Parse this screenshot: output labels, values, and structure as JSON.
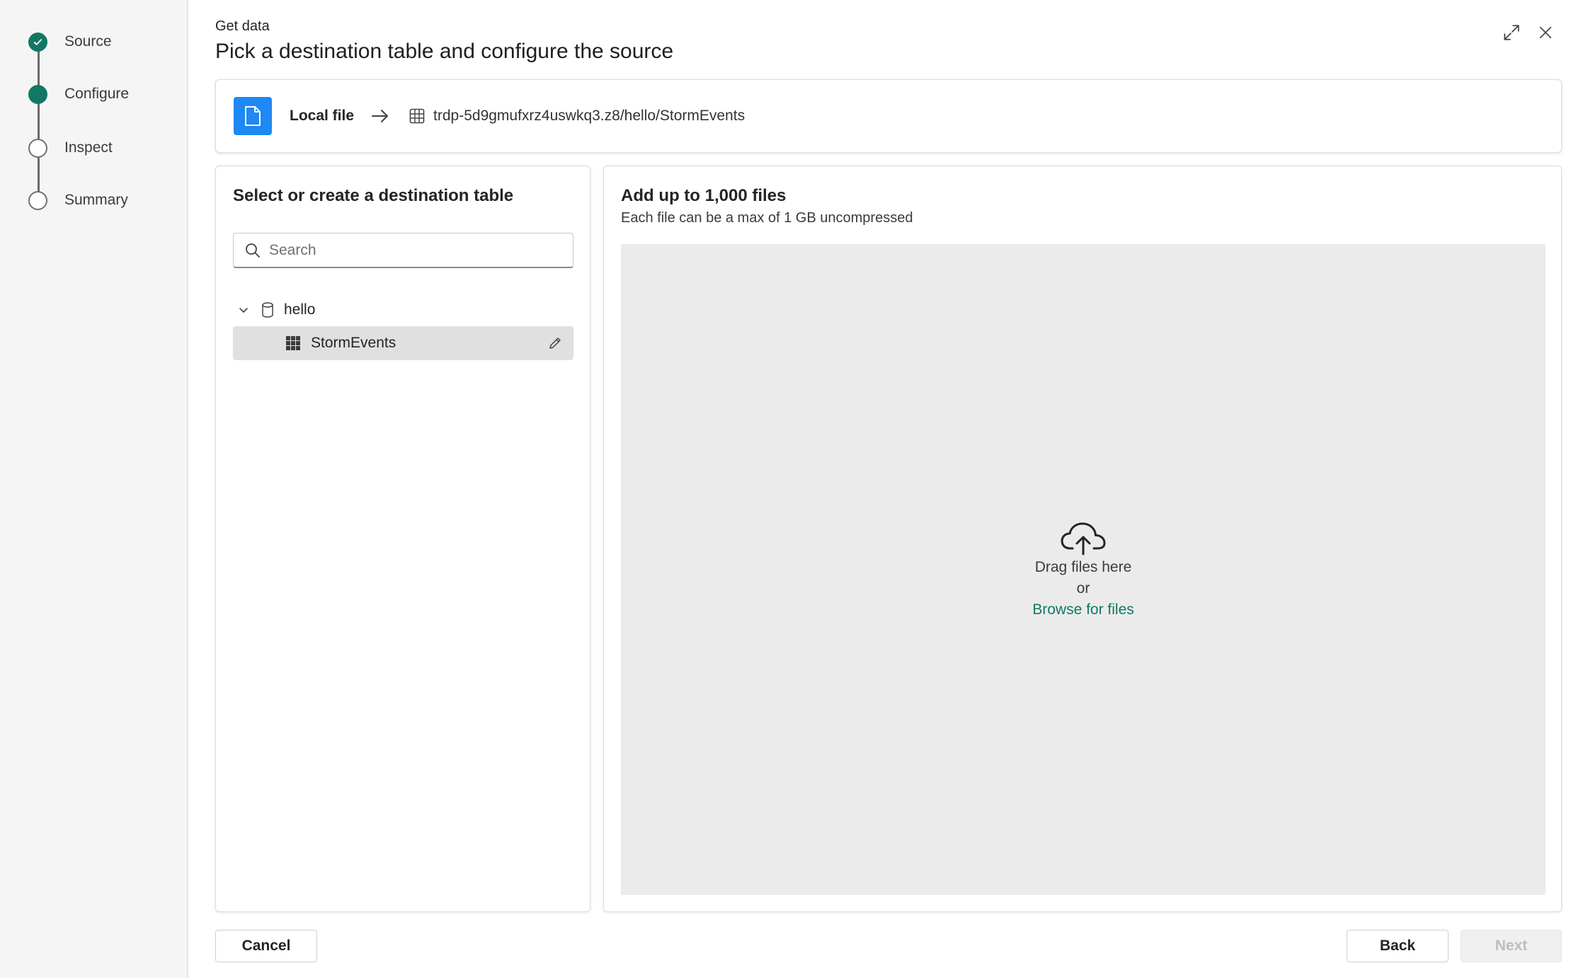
{
  "stepper": {
    "steps": [
      {
        "label": "Source",
        "state": "done"
      },
      {
        "label": "Configure",
        "state": "active"
      },
      {
        "label": "Inspect",
        "state": "pending"
      },
      {
        "label": "Summary",
        "state": "pending"
      }
    ],
    "accent_color": "#117865"
  },
  "header": {
    "subtitle": "Get data",
    "title": "Pick a destination table and configure the source"
  },
  "source_bar": {
    "source_label": "Local file",
    "destination_path": "trdp-5d9gmufxrz4uswkq3.z8/hello/StormEvents",
    "badge_color": "#1e88f5"
  },
  "left_panel": {
    "title": "Select or create a destination table",
    "search_placeholder": "Search",
    "tree": {
      "database": "hello",
      "tables": [
        "StormEvents"
      ]
    }
  },
  "right_panel": {
    "title": "Add up to 1,000 files",
    "subtitle": "Each file can be a max of 1 GB uncompressed",
    "drop_text": "Drag files here",
    "or_text": "or",
    "browse_label": "Browse for files"
  },
  "footer": {
    "cancel_label": "Cancel",
    "back_label": "Back",
    "next_label": "Next"
  }
}
